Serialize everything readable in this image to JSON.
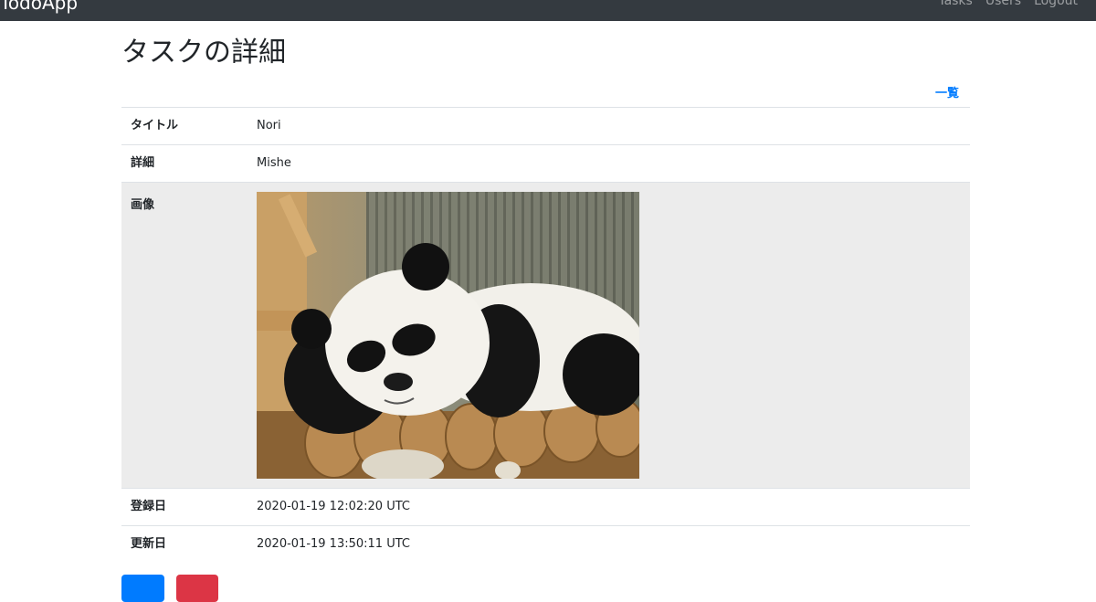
{
  "navbar": {
    "brand": "TodoApp",
    "links": [
      "Tasks",
      "Users",
      "Logout"
    ]
  },
  "page": {
    "title": "タスクの詳細",
    "list_link": "一覧"
  },
  "details": {
    "title_label": "タイトル",
    "title_value": "Nori",
    "description_label": "詳細",
    "description_value": "Mishe",
    "image_label": "画像",
    "created_label": "登録日",
    "created_value": "2020-01-19 12:02:20 UTC",
    "updated_label": "更新日",
    "updated_value": "2020-01-19 13:50:11 UTC"
  },
  "colors": {
    "navbar": "#343a40",
    "link": "#007bff",
    "edit_button": "#007bff",
    "delete_button": "#dc3545",
    "image_row_bg": "#ececec"
  }
}
